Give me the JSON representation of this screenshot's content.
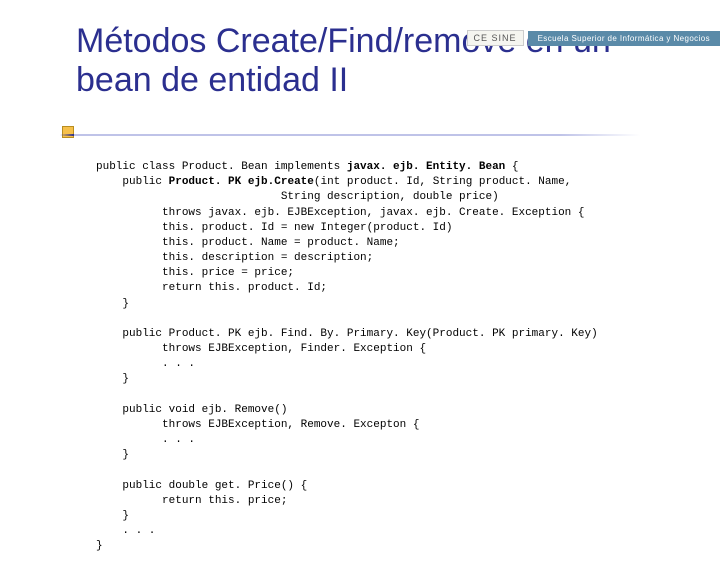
{
  "header": {
    "logo_text": "CE SINE",
    "tagline": "Escuela Superior de Informática y Negocios"
  },
  "title": "Métodos Create/Find/remove en un bean de entidad II",
  "code": {
    "l01a": "public class Product. Bean implements ",
    "l01b": "javax. ejb. Entity. Bean",
    "l01c": " {",
    "l02a": "    public ",
    "l02b": "Product. PK",
    "l02c": " ",
    "l02d": "ejb.Create",
    "l02e": "(int product. Id, String product. Name,",
    "l03": "                            String description, double price)",
    "l04": "          throws javax. ejb. EJBException, javax. ejb. Create. Exception {",
    "l05": "          this. product. Id = new Integer(product. Id)",
    "l06": "          this. product. Name = product. Name;",
    "l07": "          this. description = description;",
    "l08": "          this. price = price;",
    "l09": "          return this. product. Id;",
    "l10": "    }",
    "blank": "",
    "l11": "    public Product. PK ejb. Find. By. Primary. Key(Product. PK primary. Key)",
    "l12": "          throws EJBException, Finder. Exception {",
    "l13": "          . . .",
    "l14": "    }",
    "l15": "    public void ejb. Remove()",
    "l16": "          throws EJBException, Remove. Excepton {",
    "l17": "          . . .",
    "l18": "    }",
    "l19": "    public double get. Price() {",
    "l20": "          return this. price;",
    "l21": "    }",
    "l22": "    . . .",
    "l23": "}"
  }
}
